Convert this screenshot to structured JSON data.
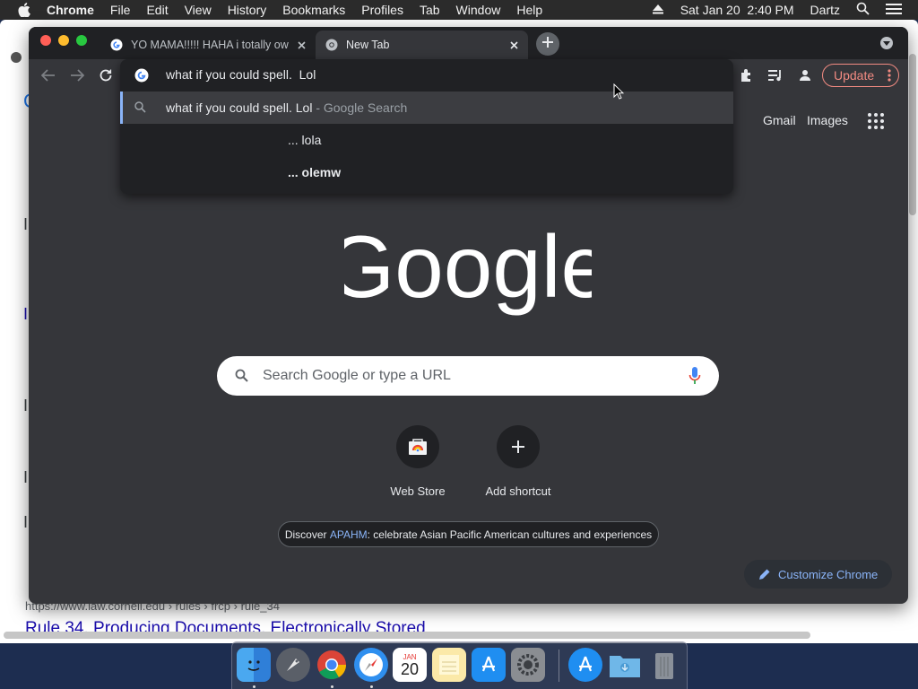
{
  "menubar": {
    "items": [
      "Chrome",
      "File",
      "Edit",
      "View",
      "History",
      "Bookmarks",
      "Profiles",
      "Tab",
      "Window",
      "Help"
    ],
    "datetime": "Sat Jan 20  2:40 PM",
    "user": "Dartz"
  },
  "background_page": {
    "url": "https://www.law.cornell.edu › rules › frcp › rule_34",
    "title": "Rule 34. Producing Documents, Electronically Stored"
  },
  "tabs": [
    {
      "title": "YO MAMA!!!!! HAHA i totally ow",
      "active": false
    },
    {
      "title": "New Tab",
      "active": true
    }
  ],
  "omnibox": {
    "input": "what if you could spell.  Lol",
    "suggestions": [
      {
        "text": "what if you could spell. Lol",
        "sub": " - Google Search"
      },
      {
        "text": "... lola",
        "sub": ""
      },
      {
        "text": "... olemw",
        "sub": ""
      }
    ]
  },
  "toolbar": {
    "update_label": "Update"
  },
  "ntp": {
    "gmail": "Gmail",
    "images": "Images",
    "search_placeholder": "Search Google or type a URL",
    "shortcuts": [
      "Web Store",
      "Add shortcut"
    ],
    "promo": {
      "pre": "Discover ",
      "highlight": "APAHM",
      "post": ": celebrate Asian Pacific American cultures and experiences"
    },
    "customize": "Customize Chrome"
  },
  "dock": {
    "calendar": {
      "month": "JAN",
      "day": "20"
    }
  },
  "colors": {
    "chrome_bg": "#35363a",
    "tabstrip": "#202124",
    "accent_blue": "#8ab4f8",
    "update_red": "#f28b82"
  }
}
